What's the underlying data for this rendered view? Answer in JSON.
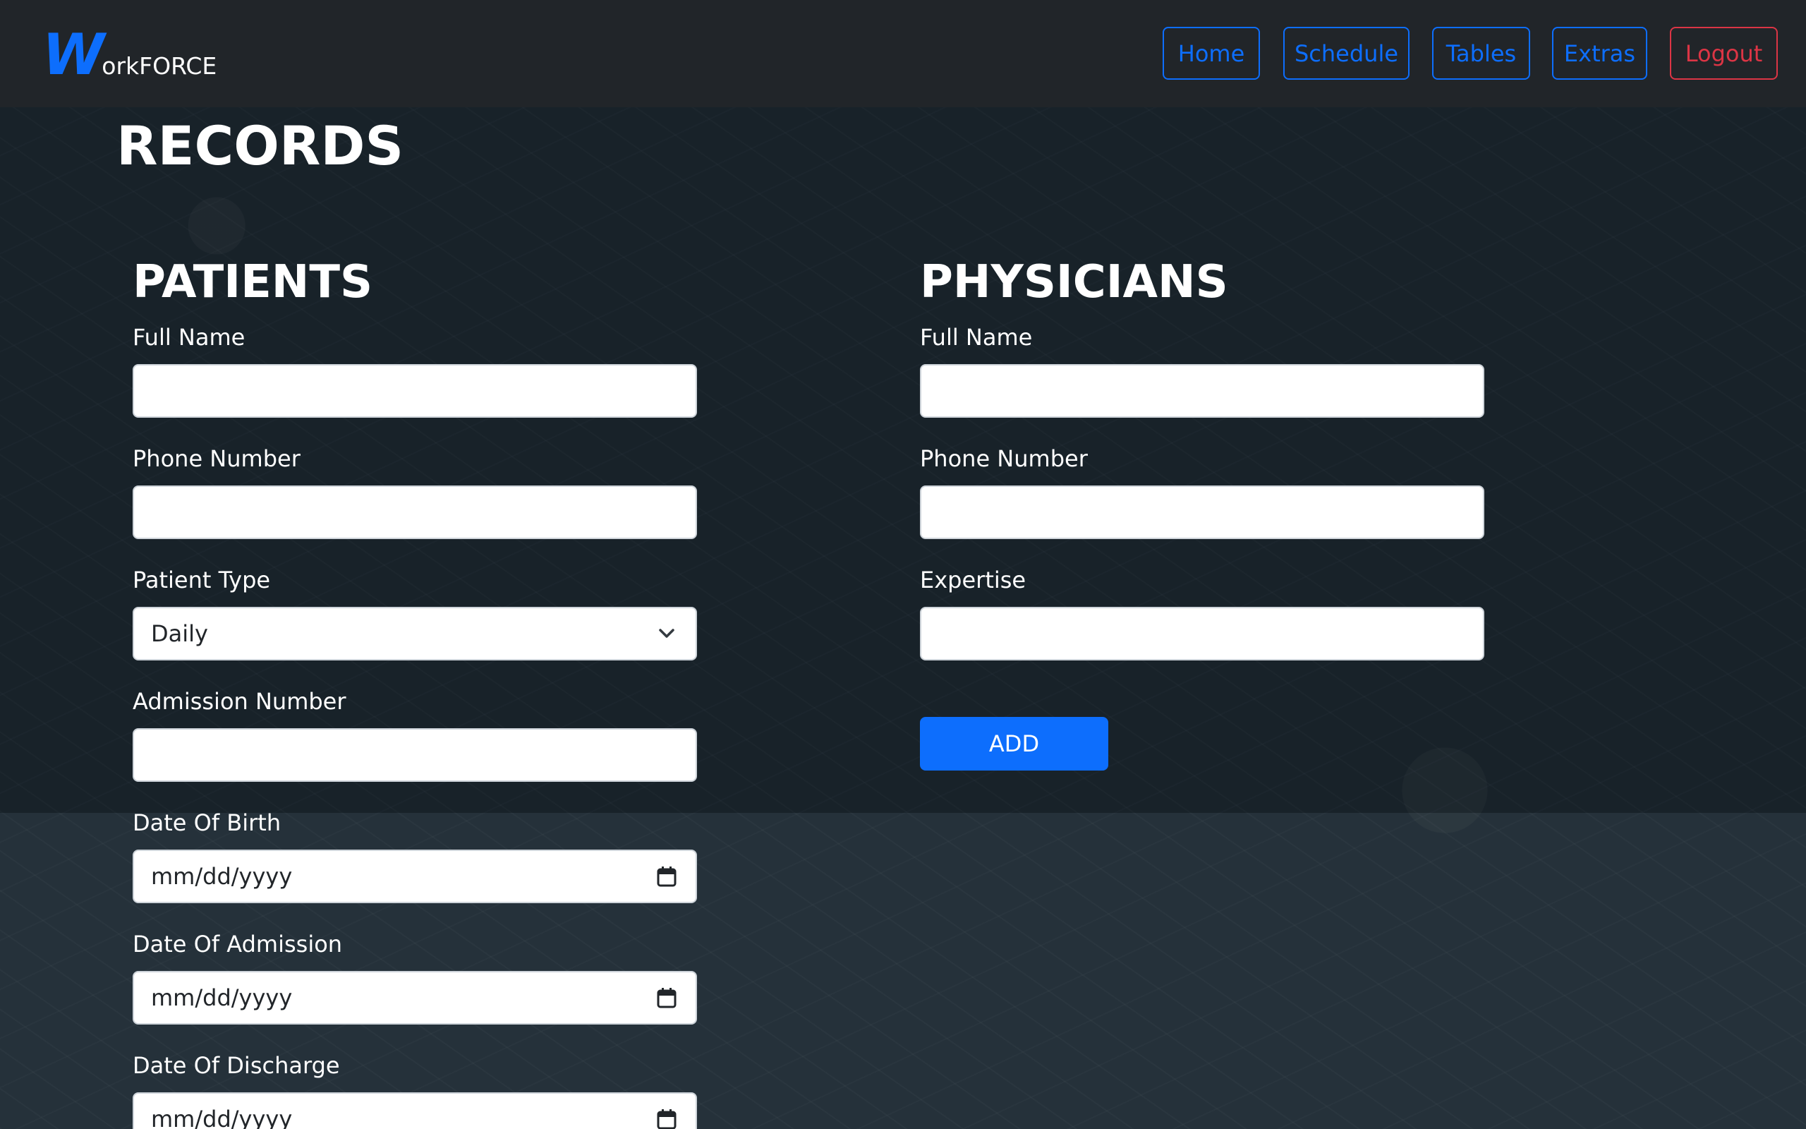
{
  "navbar": {
    "brand_letter": "W",
    "brand_rest": "orkFORCE",
    "links": [
      {
        "label": "Home"
      },
      {
        "label": "Schedule"
      },
      {
        "label": "Tables"
      },
      {
        "label": "Extras"
      },
      {
        "label": "Logout"
      }
    ]
  },
  "page": {
    "title": "RECORDS"
  },
  "patients": {
    "title": "PATIENTS",
    "full_name_label": "Full Name",
    "full_name_value": "",
    "phone_label": "Phone Number",
    "phone_value": "",
    "type_label": "Patient Type",
    "type_value": "Daily",
    "admission_label": "Admission Number",
    "admission_value": "",
    "dob_label": "Date Of Birth",
    "dob_placeholder": "mm/dd/yyyy",
    "doa_label": "Date Of Admission",
    "doa_placeholder": "mm/dd/yyyy",
    "dod_label": "Date Of Discharge",
    "dod_placeholder": "mm/dd/yyyy"
  },
  "physicians": {
    "title": "PHYSICIANS",
    "full_name_label": "Full Name",
    "full_name_value": "",
    "phone_label": "Phone Number",
    "phone_value": "",
    "expertise_label": "Expertise",
    "expertise_value": "",
    "add_label": "ADD"
  },
  "colors": {
    "accent": "#0d6efd",
    "danger": "#dc3545",
    "navbar_bg": "#212529",
    "page_bg": "#1e2a33"
  },
  "icons": {
    "select": "chevron-down-icon",
    "date": "calendar-icon"
  }
}
